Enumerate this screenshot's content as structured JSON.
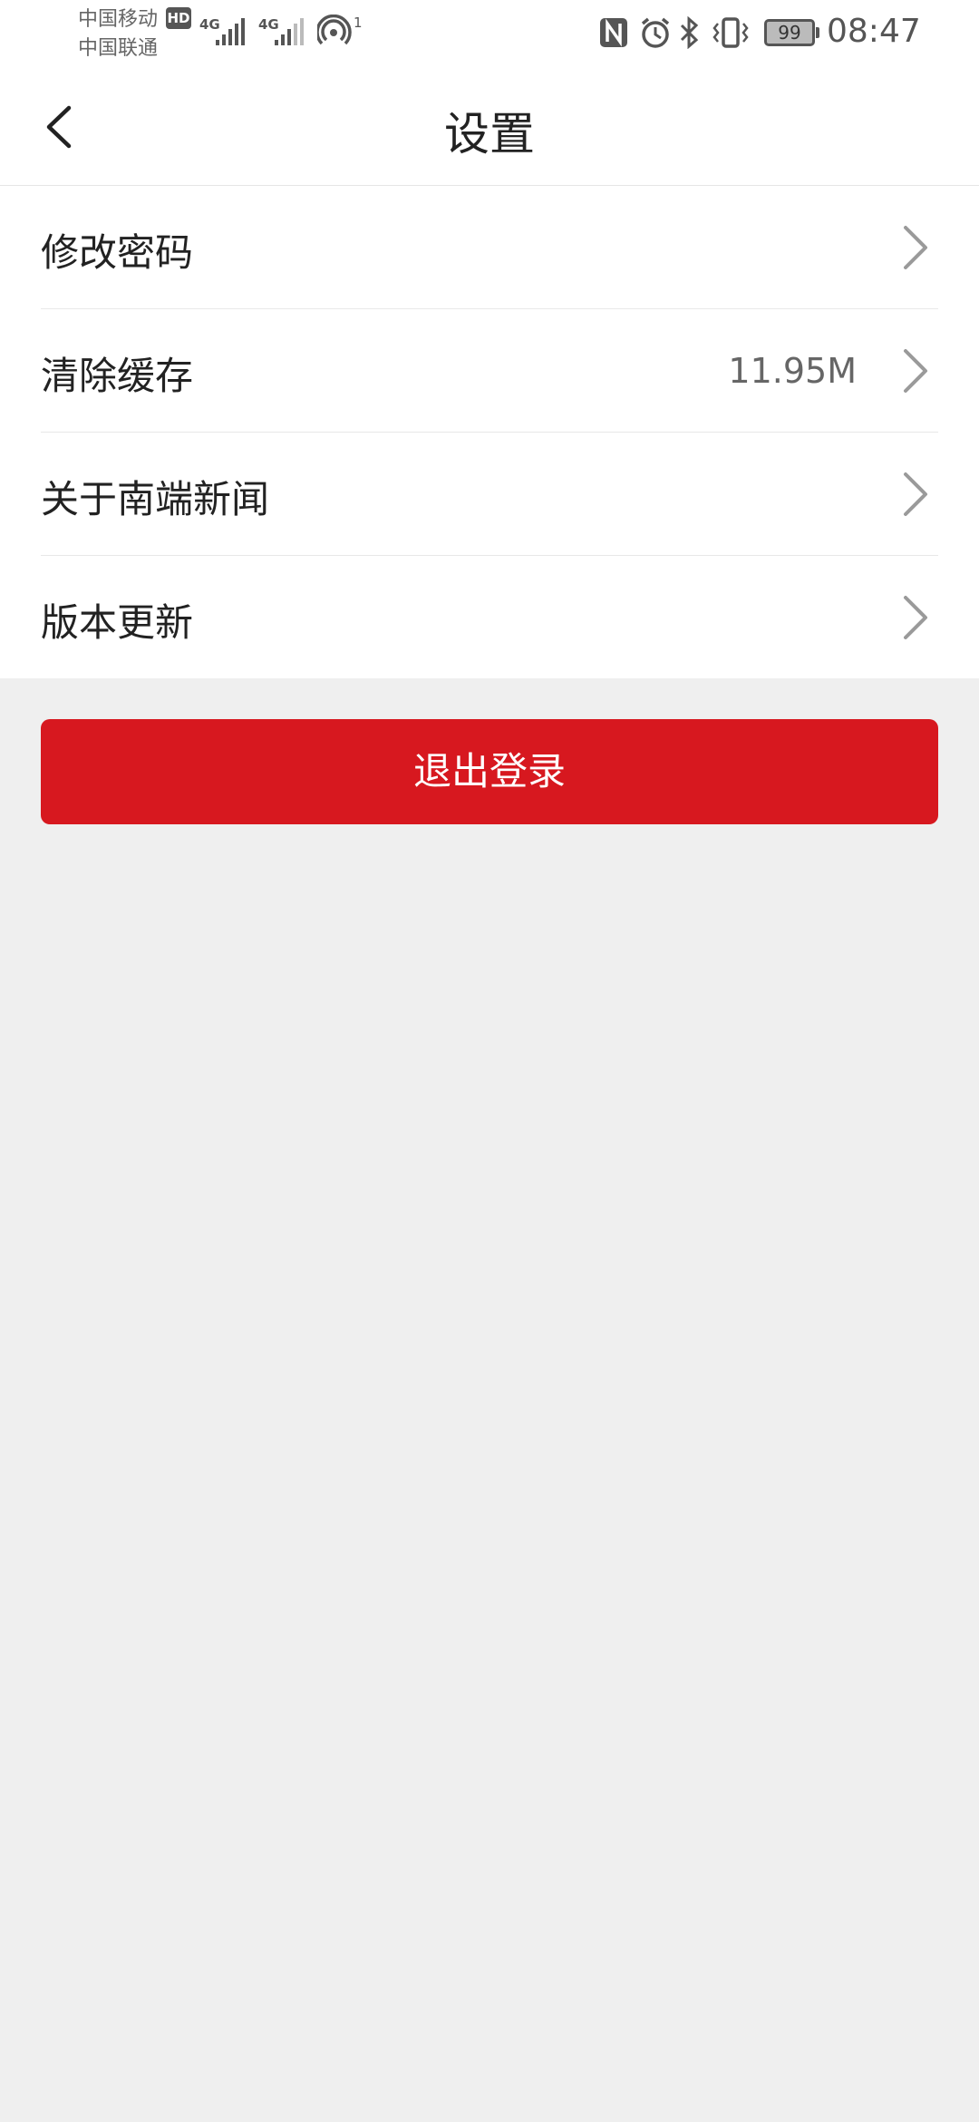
{
  "status_bar": {
    "carrier_1": "中国移动",
    "carrier_2": "中国联通",
    "hd_badge": "HD",
    "network_1": "4G",
    "network_2": "4G",
    "hotspot_count": "1",
    "battery_level": "99",
    "time": "08:47"
  },
  "nav": {
    "title": "设置"
  },
  "settings": {
    "items": [
      {
        "label": "修改密码",
        "value": ""
      },
      {
        "label": "清除缓存",
        "value": "11.95M"
      },
      {
        "label": "关于南端新闻",
        "value": ""
      },
      {
        "label": "版本更新",
        "value": ""
      }
    ]
  },
  "logout": {
    "label": "退出登录"
  },
  "colors": {
    "accent": "#d7181f",
    "page_background": "#efefef",
    "chevron": "#9a9a9a"
  }
}
